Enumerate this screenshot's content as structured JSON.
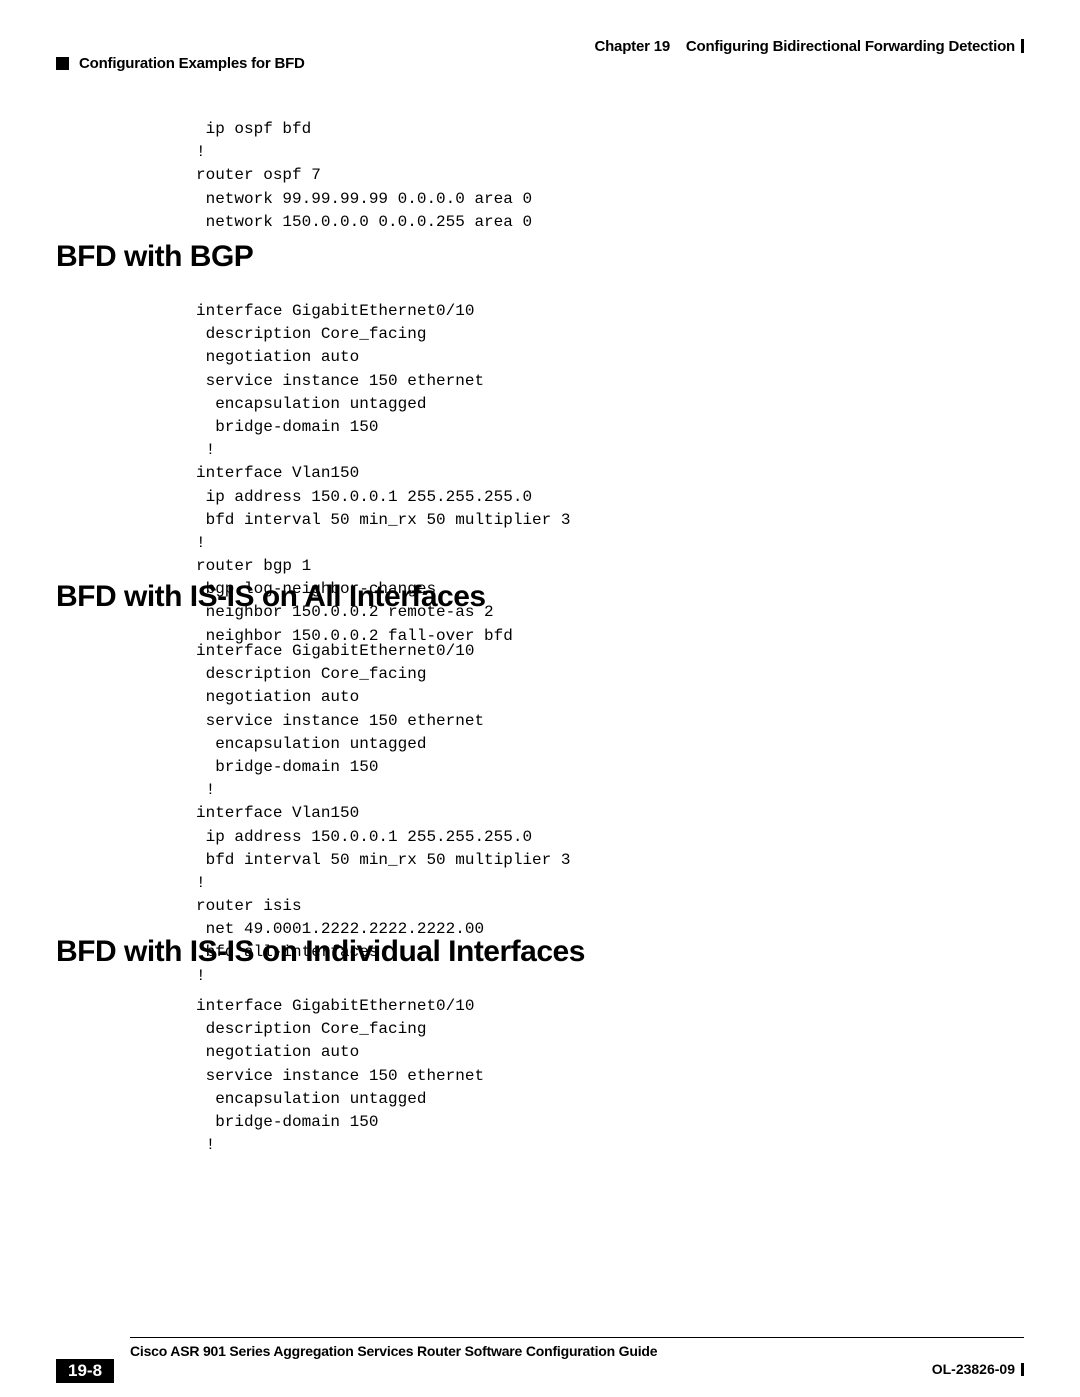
{
  "header": {
    "chapter_label": "Chapter 19",
    "chapter_title": "Configuring Bidirectional Forwarding Detection",
    "section_title": "Configuration Examples for BFD"
  },
  "sections": {
    "code_intro": " ip ospf bfd\n!\nrouter ospf 7\n network 99.99.99.99 0.0.0.0 area 0\n network 150.0.0.0 0.0.0.255 area 0",
    "heading1": "BFD with BGP",
    "code1": "interface GigabitEthernet0/10\n description Core_facing\n negotiation auto\n service instance 150 ethernet\n  encapsulation untagged\n  bridge-domain 150\n !\ninterface Vlan150\n ip address 150.0.0.1 255.255.255.0\n bfd interval 50 min_rx 50 multiplier 3\n!\nrouter bgp 1\n bgp log-neighbor-changes\n neighbor 150.0.0.2 remote-as 2\n neighbor 150.0.0.2 fall-over bfd",
    "heading2": "BFD with IS-IS on All Interfaces",
    "code2": "interface GigabitEthernet0/10\n description Core_facing\n negotiation auto\n service instance 150 ethernet\n  encapsulation untagged\n  bridge-domain 150\n !\ninterface Vlan150\n ip address 150.0.0.1 255.255.255.0\n bfd interval 50 min_rx 50 multiplier 3\n!\nrouter isis\n net 49.0001.2222.2222.2222.00\n bfd all-interfaces\n!",
    "heading3": "BFD with IS-IS on Individual Interfaces",
    "code3": "interface GigabitEthernet0/10\n description Core_facing\n negotiation auto\n service instance 150 ethernet\n  encapsulation untagged\n  bridge-domain 150\n !"
  },
  "footer": {
    "guide_title": "Cisco ASR 901 Series Aggregation Services Router Software Configuration Guide",
    "page_number": "19-8",
    "doc_id": "OL-23826-09"
  }
}
